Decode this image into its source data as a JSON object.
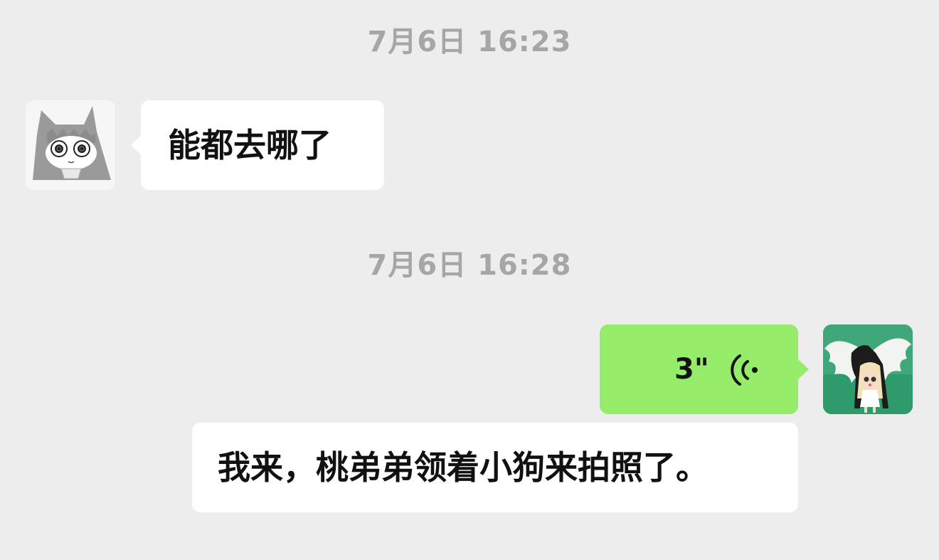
{
  "messages": [
    {
      "type": "timestamp",
      "text": "7月6日 16:23"
    },
    {
      "type": "text",
      "direction": "incoming",
      "text": "能都去哪了"
    },
    {
      "type": "timestamp",
      "text": "7月6日 16:28"
    },
    {
      "type": "voice",
      "direction": "outgoing",
      "duration": "3\""
    },
    {
      "type": "text",
      "direction": "outgoing",
      "text": "我来，桃弟弟领着小狗来拍照了。"
    }
  ],
  "colors": {
    "background": "#ededed",
    "incoming_bubble": "#ffffff",
    "voice_bubble": "#95ec69",
    "timestamp_text": "#a6a6a6"
  },
  "icons": {
    "contact_avatar": "cartoon-cat-avatar",
    "self_avatar": "angel-girl-avatar",
    "voice": "voice-wave-icon"
  }
}
